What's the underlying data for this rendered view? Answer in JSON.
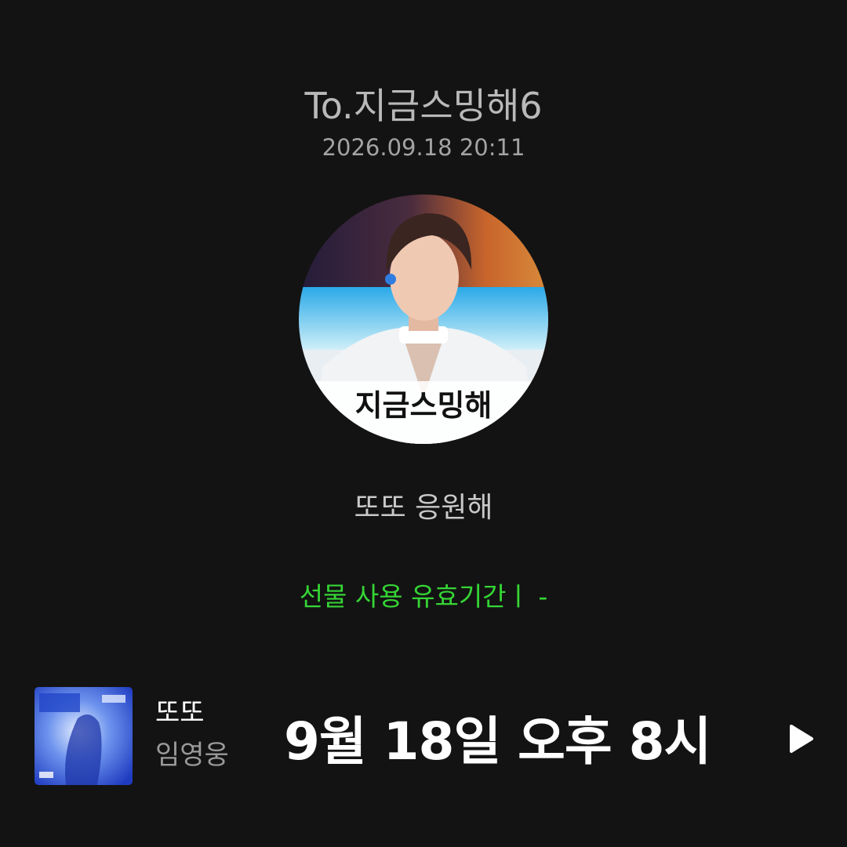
{
  "gift": {
    "recipient": "To.지금스밍해6",
    "sent_datetime": "2026.09.18 20:11",
    "avatar_caption": "지금스밍해",
    "message": "또또 응원해",
    "validity": "선물 사용 유효기간ㅣ  -"
  },
  "player": {
    "song_title": "또또",
    "artist": "임영웅",
    "overlay_caption": "9월 18일 오후 8시",
    "play_icon": "play-icon"
  },
  "colors": {
    "background": "#131313",
    "accent_green": "#35d535",
    "text_primary": "#ffffff",
    "text_secondary": "#9a9a9a"
  }
}
